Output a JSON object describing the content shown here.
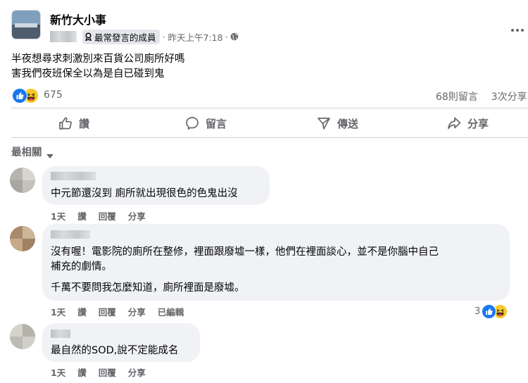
{
  "post": {
    "page_name": "新竹大小事",
    "badge_label": "最常發言的成員",
    "time": "昨天上午7:18",
    "separator": "·",
    "text_line1": "半夜想尋求刺激別來百貨公司廁所好嗎",
    "text_line2": "害我們夜班保全以為是自已碰到鬼",
    "reaction_count": "675",
    "comments_count": "68則留言",
    "shares_count": "3次分享",
    "reaction_icons": [
      "like-icon",
      "haha-icon"
    ]
  },
  "actions": {
    "like": "讚",
    "comment": "留言",
    "send": "傳送",
    "share": "分享"
  },
  "sort": {
    "label": "最相關"
  },
  "comments": [
    {
      "text": "中元節還沒到 廁所就出現很色的色鬼出沒",
      "time": "1天",
      "like": "讚",
      "reply": "回覆",
      "share": "分享"
    },
    {
      "text_line1": "沒有喔！電影院的廁所在整修，裡面跟廢墟一樣，他們在裡面談心，並不是你腦中自己",
      "text_line2": "補充的劇情。",
      "text_line3": "千萬不要問我怎麼知道，廁所裡面是廢墟。",
      "time": "1天",
      "like": "讚",
      "reply": "回覆",
      "share": "分享",
      "edited": "已編輯",
      "reaction_count": "3"
    },
    {
      "text": "最自然的SOD,說不定能成名",
      "time": "1天",
      "like": "讚",
      "reply": "回覆",
      "share": "分享"
    }
  ],
  "colors": {
    "accent": "#1877f2",
    "bubble": "#f0f2f5",
    "muted": "#65676b"
  }
}
